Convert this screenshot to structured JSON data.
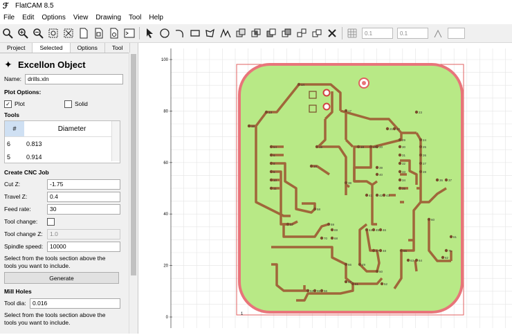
{
  "window": {
    "title": "FlatCAM 8.5"
  },
  "menu": [
    "File",
    "Edit",
    "Options",
    "View",
    "Drawing",
    "Tool",
    "Help"
  ],
  "toolbar": {
    "grid_x": "0.1",
    "grid_y": "0.1"
  },
  "tabs": [
    "Project",
    "Selected",
    "Options",
    "Tool"
  ],
  "object": {
    "heading": "Excellon Object",
    "name_label": "Name:",
    "name_value": "drills.xln",
    "plot_options_label": "Plot Options:",
    "plot_label": "Plot",
    "solid_label": "Solid",
    "tools_label": "Tools",
    "tools_table": {
      "headers": [
        "#",
        "Diameter"
      ],
      "rows": [
        {
          "num": "6",
          "dia": "0.813"
        },
        {
          "num": "5",
          "dia": "0.914"
        }
      ]
    }
  },
  "cnc": {
    "section": "Create CNC Job",
    "cut_z_label": "Cut Z:",
    "cut_z": "-1.75",
    "travel_z_label": "Travel Z:",
    "travel_z": "0.4",
    "feed_label": "Feed rate:",
    "feed": "30",
    "toolchange_label": "Tool change:",
    "toolchange_z_label": "Tool change Z:",
    "toolchange_z": "1.0",
    "spindle_label": "Spindle speed:",
    "spindle": "10000",
    "note": "Select from the tools section above the tools you want to include.",
    "generate": "Generate"
  },
  "mill": {
    "section": "Mill Holes",
    "tool_dia_label": "Tool dia:",
    "tool_dia": "0.016",
    "note": "Select from the tools section above the tools you want to include."
  },
  "plot": {
    "y_ticks": [
      "100",
      "80",
      "60",
      "40",
      "20",
      "0"
    ],
    "origin_label": "1",
    "colors": {
      "board_fill": "#b8e986",
      "board_outline": "#e8757a",
      "trace": "#a0663a",
      "pad": "#7a4a2a"
    },
    "pad_labels": [
      "54",
      "6",
      "8",
      "5",
      "10",
      "11",
      "12",
      "13",
      "14",
      "15",
      "16",
      "17",
      "18",
      "19",
      "20",
      "21",
      "22",
      "23",
      "24",
      "25",
      "26",
      "27",
      "28",
      "29",
      "30",
      "31",
      "32",
      "33",
      "34",
      "35",
      "36",
      "37",
      "38",
      "39",
      "40",
      "41",
      "42",
      "43",
      "44",
      "45",
      "46",
      "47",
      "48",
      "49",
      "50",
      "51",
      "52",
      "53",
      "55",
      "56",
      "57",
      "58",
      "59",
      "60",
      "61",
      "62",
      "63",
      "64",
      "65",
      "66",
      "67",
      "68",
      "69",
      "70",
      "71"
    ]
  }
}
